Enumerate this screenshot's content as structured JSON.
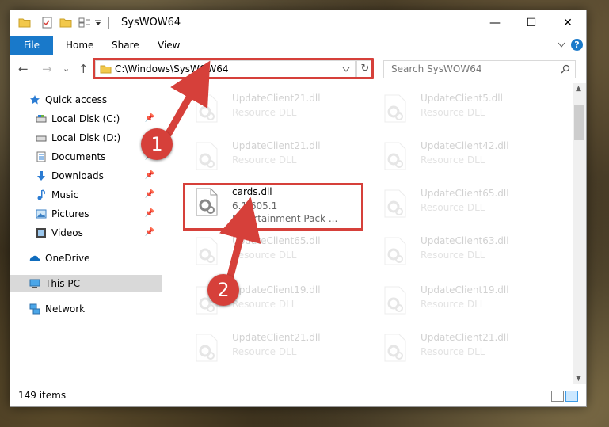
{
  "window": {
    "title": "SysWOW64",
    "minimize_glyph": "—",
    "maximize_glyph": "☐",
    "close_glyph": "✕"
  },
  "ribbon": {
    "tabs": [
      "File",
      "Home",
      "Share",
      "View"
    ],
    "help": "?",
    "accent": "#1979ca"
  },
  "nav": {
    "back": "←",
    "forward": "→",
    "recent": "⌄",
    "up": "↑",
    "address": "C:\\Windows\\SysWOW64",
    "refresh": "↻",
    "search_placeholder": "Search SysWOW64"
  },
  "sidebar": {
    "items": [
      {
        "label": "Quick access",
        "icon": "star-icon",
        "pinned": false
      },
      {
        "label": "Local Disk (C:)",
        "icon": "drive-icon",
        "pinned": true
      },
      {
        "label": "Local Disk (D:)",
        "icon": "drive-icon",
        "pinned": false
      },
      {
        "label": "Documents",
        "icon": "documents-icon",
        "pinned": true
      },
      {
        "label": "Downloads",
        "icon": "download-icon",
        "pinned": true
      },
      {
        "label": "Music",
        "icon": "music-icon",
        "pinned": true
      },
      {
        "label": "Pictures",
        "icon": "pictures-icon",
        "pinned": true
      },
      {
        "label": "Videos",
        "icon": "videos-icon",
        "pinned": true
      },
      {
        "label": "OneDrive",
        "icon": "cloud-icon",
        "pinned": false
      },
      {
        "label": "This PC",
        "icon": "computer-icon",
        "pinned": false
      },
      {
        "label": "Network",
        "icon": "network-icon",
        "pinned": false
      }
    ]
  },
  "files": [
    {
      "name": "UpdateClient21.dll",
      "desc": "Resource DLL"
    },
    {
      "name": "UpdateClient5.dll",
      "desc": "Resource DLL"
    },
    {
      "name": "UpdateClient21.dll",
      "desc": "Resource DLL"
    },
    {
      "name": "UpdateClient42.dll",
      "desc": "Resource DLL"
    },
    {
      "name": "cards.dll",
      "desc": "6.1.605.1",
      "sub": "Entertainment Pack ..."
    },
    {
      "name": "UpdateClient65.dll",
      "desc": "Resource DLL"
    },
    {
      "name": "UpdateClient65.dll",
      "desc": "Resource DLL"
    },
    {
      "name": "UpdateClient63.dll",
      "desc": "Resource DLL"
    },
    {
      "name": "UpdateClient19.dll",
      "desc": "Resource DLL"
    },
    {
      "name": "UpdateClient19.dll",
      "desc": "Resource DLL"
    },
    {
      "name": "UpdateClient21.dll",
      "desc": "Resource DLL"
    },
    {
      "name": "UpdateClient21.dll",
      "desc": "Resource DLL"
    }
  ],
  "status": {
    "item_count": "149 items"
  },
  "annotations": {
    "marker_1": "1",
    "marker_2": "2",
    "color": "#d6403a"
  }
}
